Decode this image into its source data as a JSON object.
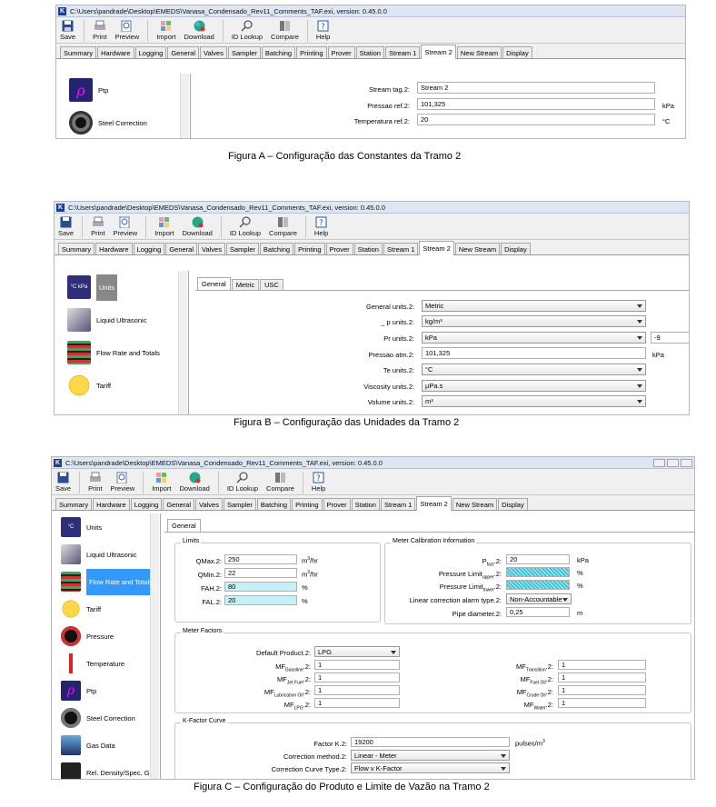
{
  "title_path": "C:\\Users\\pandrade\\Desktop\\EMEDS\\Vanasa_Condensado_Rev11_Comments_TAF.exi, version: 0.45.0.0",
  "app_letter": "K",
  "toolbar": {
    "save": "Save",
    "print": "Print",
    "preview": "Preview",
    "import": "Import",
    "download": "Download",
    "id_lookup": "ID Lookup",
    "compare": "Compare",
    "help": "Help"
  },
  "tabs": [
    "Summary",
    "Hardware",
    "Logging",
    "General",
    "Valves",
    "Sampler",
    "Batching",
    "Printing",
    "Prover",
    "Station",
    "Stream 1",
    "Stream 2",
    "New Stream",
    "Display"
  ],
  "figA": {
    "caption": "Figura A – Configuração das Constantes da Tramo 2",
    "side": [
      {
        "label": "Ptp",
        "icon": "ptp-icon"
      },
      {
        "label": "Steel Correction",
        "icon": "steel-correction-icon"
      }
    ],
    "fields": [
      {
        "label": "Stream tag.2:",
        "value": "Stream 2",
        "unit": ""
      },
      {
        "label": "Pressao ref.2:",
        "value": "101,325",
        "unit": "kPa"
      },
      {
        "label": "Temperatura ref.2:",
        "value": "20",
        "unit": "°C"
      }
    ]
  },
  "figB": {
    "caption": "Figura B – Configuração das Unidades da Tramo 2",
    "side": [
      "Units",
      "Liquid Ultrasonic",
      "Flow Rate and Totals",
      "Tariff"
    ],
    "subtabs": [
      "General",
      "Metric",
      "USC"
    ],
    "fields": [
      {
        "label": "General units.2:",
        "value": "Metric"
      },
      {
        "label": "_ p units.2:",
        "value": "kg/m³"
      },
      {
        "label": "Pr units.2:",
        "value": "kPa",
        "extra": "-9"
      },
      {
        "label": "Pressao atm.2:",
        "value": "101,325",
        "unit": "kPa"
      },
      {
        "label": "Te units.2:",
        "value": "°C"
      },
      {
        "label": "Viscosity units.2:",
        "value": "µPa.s"
      },
      {
        "label": "Volume units.2:",
        "value": "m³"
      }
    ]
  },
  "figC": {
    "caption": "Figura C – Configuração do Produto e Limite de Vazão na Tramo 2",
    "side": [
      "Units",
      "Liquid Ultrasonic",
      "Flow Rate and Totals",
      "Tariff",
      "Pressure",
      "Temperature",
      "Ptp",
      "Steel Correction",
      "Gas Data",
      "Rel. Density/Spec. Grav"
    ],
    "subtab": "General",
    "limits": {
      "title": "Limits",
      "rows": [
        {
          "label": "QMax.2:",
          "value": "250",
          "unit": "m³/hr"
        },
        {
          "label": "QMin.2:",
          "value": "22",
          "unit": "m³/hr"
        },
        {
          "label": "FAH.2:",
          "value": "80",
          "unit": "%"
        },
        {
          "label": "FAL.2:",
          "value": "20",
          "unit": "%"
        }
      ]
    },
    "meter_cal": {
      "title": "Meter Calibration Information",
      "rows": [
        {
          "label": "Pfact.2:",
          "value": "20",
          "unit": "kPa"
        },
        {
          "label": "Pressure Limit upper.2:",
          "value": "",
          "unit": "%"
        },
        {
          "label": "Pressure Limit lower.2:",
          "value": "",
          "unit": "%"
        },
        {
          "label": "Linear correction alarm type.2:",
          "value": "Non-Accountable",
          "unit": ""
        },
        {
          "label": "Pipe diameter.2:",
          "value": "0,25",
          "unit": "m"
        }
      ]
    },
    "meter_factors": {
      "title": "Meter Factors",
      "product_label": "Default Product.2:",
      "product": "LPG",
      "left": [
        {
          "label": "MF Gasoline.2:",
          "value": "1"
        },
        {
          "label": "MF Jet Fuel.2:",
          "value": "1"
        },
        {
          "label": "MF Lubrication Oil.2:",
          "value": "1"
        },
        {
          "label": "MF LPG.2:",
          "value": "1"
        }
      ],
      "right": [
        {
          "label": "MF Transition.2:",
          "value": "1"
        },
        {
          "label": "MF Fuel Oil.2:",
          "value": "1"
        },
        {
          "label": "MF Crude Oil.2:",
          "value": "1"
        },
        {
          "label": "MF Water.2:",
          "value": "1"
        }
      ]
    },
    "kfactor": {
      "title": "K-Factor Curve",
      "rows": [
        {
          "label": "Factor K.2:",
          "value": "19200",
          "unit": "pulses/m³"
        },
        {
          "label": "Correction method.2:",
          "value": "Linear - Meter",
          "unit": ""
        },
        {
          "label": "Correction Curve Type.2:",
          "value": "Flow v K-Factor",
          "unit": ""
        }
      ]
    }
  }
}
